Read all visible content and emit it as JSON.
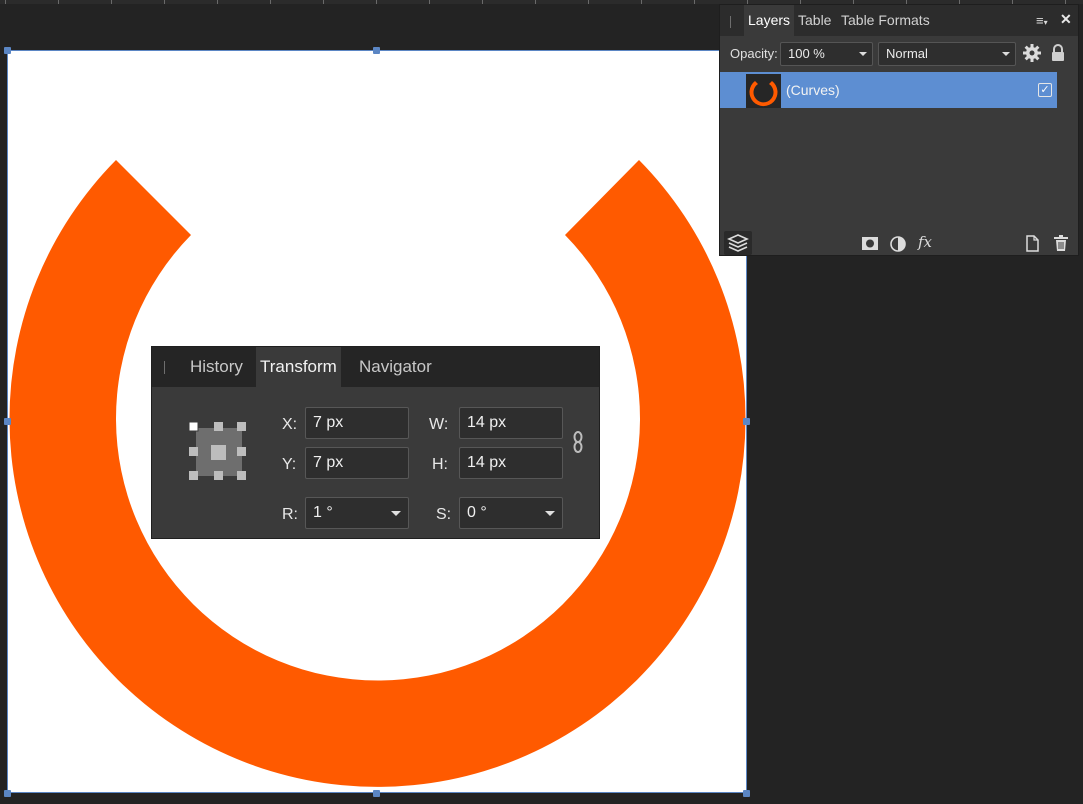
{
  "colors": {
    "accent_orange": "#ff5a00",
    "selection_blue": "#5d8ed2",
    "panel_bg": "#3a3a3a",
    "app_bg": "#232323"
  },
  "layers_panel": {
    "tabs": [
      {
        "label": "Layers",
        "active": true
      },
      {
        "label": "Table",
        "active": false
      },
      {
        "label": "Table Formats",
        "active": false
      }
    ],
    "menu_icon": "menu-icon",
    "close_icon": "close-icon",
    "opacity_label": "Opacity:",
    "opacity_value": "100 %",
    "blend_mode": "Normal",
    "layers": [
      {
        "name": "(Curves)",
        "visible": true,
        "selected": true
      }
    ],
    "footer_icons": [
      "layers-stack-icon",
      "mask-icon",
      "adjustment-icon",
      "fx-icon",
      "new-layer-icon",
      "trash-icon"
    ],
    "fx_label": "fx"
  },
  "transform_panel": {
    "tabs": [
      {
        "label": "History",
        "active": false
      },
      {
        "label": "Transform",
        "active": true
      },
      {
        "label": "Navigator",
        "active": false
      }
    ],
    "fields": {
      "x": {
        "label": "X:",
        "value": "7 px"
      },
      "y": {
        "label": "Y:",
        "value": "7 px"
      },
      "w": {
        "label": "W:",
        "value": "14 px"
      },
      "h": {
        "label": "H:",
        "value": "14 px"
      },
      "r": {
        "label": "R:",
        "value": "1 °"
      },
      "s": {
        "label": "S:",
        "value": "0 °"
      }
    }
  }
}
